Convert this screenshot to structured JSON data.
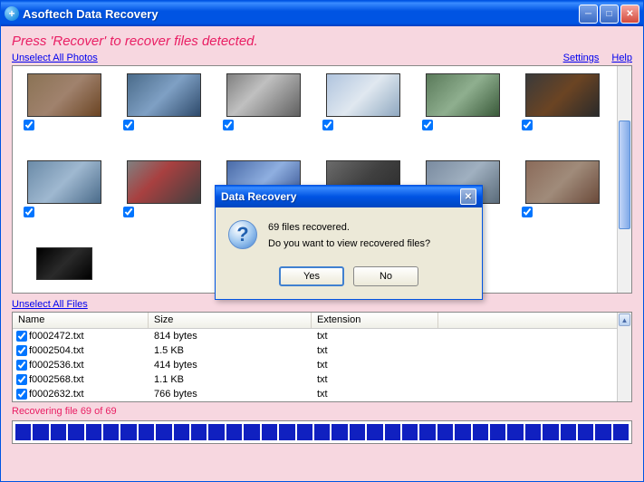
{
  "window": {
    "title": "Asoftech Data Recovery"
  },
  "instruction": "Press 'Recover' to recover files detected.",
  "links": {
    "unselect_photos": "Unselect All Photos",
    "settings": "Settings",
    "help": "Help",
    "unselect_files": "Unselect All Files"
  },
  "file_table": {
    "headers": {
      "name": "Name",
      "size": "Size",
      "ext": "Extension"
    },
    "rows": [
      {
        "name": "f0002472.txt",
        "size": "814 bytes",
        "ext": "txt"
      },
      {
        "name": "f0002504.txt",
        "size": "1.5 KB",
        "ext": "txt"
      },
      {
        "name": "f0002536.txt",
        "size": "414 bytes",
        "ext": "txt"
      },
      {
        "name": "f0002568.txt",
        "size": "1.1 KB",
        "ext": "txt"
      },
      {
        "name": "f0002632.txt",
        "size": "766 bytes",
        "ext": "txt"
      }
    ]
  },
  "status": "Recovering file 69 of 69",
  "dialog": {
    "title": "Data Recovery",
    "line1": "69 files recovered.",
    "line2": "Do you want to view recovered files?",
    "yes": "Yes",
    "no": "No"
  }
}
